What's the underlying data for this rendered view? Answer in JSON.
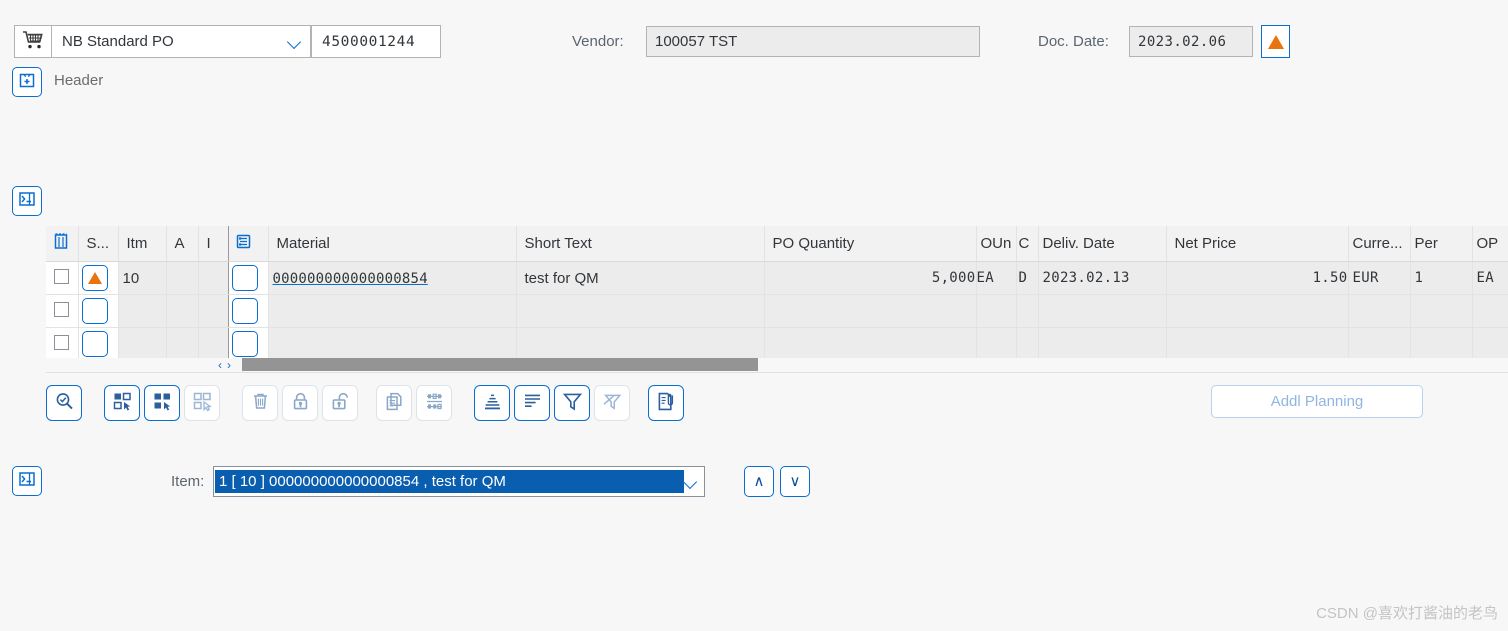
{
  "topbar": {
    "cart_icon": "shopping-cart-icon",
    "doc_type": "NB Standard PO",
    "po_number": "4500001244",
    "vendor_label": "Vendor:",
    "vendor_value": "100057 TST",
    "doc_date_label": "Doc. Date:",
    "doc_date_value": "2023.02.06",
    "alert_icon": "orange-triangle-icon"
  },
  "header_section": {
    "expand_icon": "expand-header-icon",
    "title": "Header"
  },
  "panels": {
    "items_toggle_icon": "collapse-panel-icon",
    "detail_toggle_icon": "collapse-panel-icon"
  },
  "table": {
    "select_all_icon": "table-settings-icon",
    "material_col_icon": "material-info-icon",
    "columns": [
      {
        "key": "chk",
        "label": ""
      },
      {
        "key": "st",
        "label": "S..."
      },
      {
        "key": "itm",
        "label": "Itm"
      },
      {
        "key": "a",
        "label": "A"
      },
      {
        "key": "i",
        "label": "I"
      },
      {
        "key": "micon",
        "label": ""
      },
      {
        "key": "mat",
        "label": "Material"
      },
      {
        "key": "stx",
        "label": "Short Text"
      },
      {
        "key": "qty",
        "label": "PO Quantity"
      },
      {
        "key": "oun",
        "label": "OUn"
      },
      {
        "key": "cc",
        "label": "C"
      },
      {
        "key": "del",
        "label": "Deliv. Date"
      },
      {
        "key": "np",
        "label": "Net Price"
      },
      {
        "key": "cur",
        "label": "Curre..."
      },
      {
        "key": "per",
        "label": "Per"
      },
      {
        "key": "opu",
        "label": "OP"
      }
    ],
    "rows": [
      {
        "status_icon": "orange-triangle-icon",
        "itm": "10",
        "a": "",
        "i": "",
        "material": "000000000000000854",
        "short_text": "test for QM",
        "po_quantity": "5,000",
        "oun": "EA",
        "c": "D",
        "deliv_date": "2023.02.13",
        "net_price": "1.50",
        "currency": "EUR",
        "per": "1",
        "opun": "EA"
      },
      {
        "status_icon": "",
        "itm": "",
        "a": "",
        "i": "",
        "material": "",
        "short_text": "",
        "po_quantity": "",
        "oun": "",
        "c": "",
        "deliv_date": "",
        "net_price": "",
        "currency": "",
        "per": "",
        "opun": ""
      },
      {
        "status_icon": "",
        "itm": "",
        "a": "",
        "i": "",
        "material": "",
        "short_text": "",
        "po_quantity": "",
        "oun": "",
        "c": "",
        "deliv_date": "",
        "net_price": "",
        "currency": "",
        "per": "",
        "opun": ""
      }
    ],
    "scroll_left_glyph": "‹",
    "scroll_right_glyph": "›"
  },
  "toolbar": {
    "buttons": [
      {
        "name": "details-button",
        "icon": "magnifier-check-icon",
        "state": "active"
      },
      {
        "name": "select-mode-button",
        "icon": "select-blocks-icon",
        "state": "active"
      },
      {
        "name": "select-all-button",
        "icon": "select-all-filled-icon",
        "state": "active"
      },
      {
        "name": "deselect-all-button",
        "icon": "select-none-icon",
        "state": "dim"
      },
      {
        "name": "delete-row-button",
        "icon": "trash-icon",
        "state": "dim"
      },
      {
        "name": "lock-button",
        "icon": "lock-icon",
        "state": "dim"
      },
      {
        "name": "unlock-button",
        "icon": "unlock-icon",
        "state": "dim"
      },
      {
        "name": "copy-button",
        "icon": "copy-icon",
        "state": "dim"
      },
      {
        "name": "mass-change-button",
        "icon": "abacus-icon",
        "state": "dim"
      },
      {
        "name": "subtotal-button",
        "icon": "subtotal-icon",
        "state": "active"
      },
      {
        "name": "sort-button",
        "icon": "sort-lines-icon",
        "state": "active"
      },
      {
        "name": "filter-button",
        "icon": "filter-icon",
        "state": "active"
      },
      {
        "name": "clear-filter-button",
        "icon": "filter-clear-icon",
        "state": "dim"
      },
      {
        "name": "attachment-button",
        "icon": "document-attach-icon",
        "state": "active"
      }
    ],
    "addl_planning_label": "Addl Planning"
  },
  "item_selector": {
    "label": "Item:",
    "value": "1 [ 10 ] 000000000000000854 , test for QM",
    "prev_glyph": "∧",
    "next_glyph": "∨"
  },
  "watermark": "CSDN @喜欢打酱油的老鸟",
  "colors": {
    "accent_blue": "#0a6ed1",
    "selection_blue": "#0a5eb0",
    "warning_orange": "#e9730c",
    "page_bg": "#f7f7f7",
    "field_disabled_bg": "#ececec"
  }
}
